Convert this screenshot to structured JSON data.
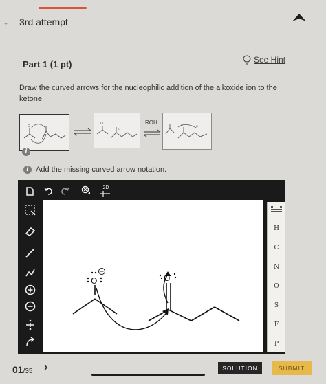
{
  "header": {
    "attempt_title": "3rd attempt",
    "accent_color": "#d9533a"
  },
  "part": {
    "title": "Part 1 (1 pt)",
    "hint_label": "See Hint"
  },
  "question": {
    "text": "Draw the curved arrows for the nucleophilic addition of the alkoxide ion to the ketone."
  },
  "mechanism": {
    "reagent_label": "ROH",
    "info_badge": "i"
  },
  "instruction": {
    "badge": "i",
    "text": "Add the missing curved arrow notation."
  },
  "toolbar": {
    "top_tools": [
      "document-icon",
      "undo-icon",
      "redo-icon",
      "zoom-icon",
      "2d-icon"
    ],
    "zoom_tool_label": "2D",
    "left_tools": [
      "select-icon",
      "eraser-icon",
      "bond-icon",
      "chain-icon",
      "plus-charge-icon",
      "minus-charge-icon",
      "electrons-icon",
      "curved-arrow-icon"
    ]
  },
  "periodic": {
    "elements": [
      "H",
      "C",
      "N",
      "O",
      "S",
      "F",
      "P"
    ]
  },
  "footer": {
    "page": "01",
    "total": "/35",
    "solution_label": "SOLUTION",
    "submit_label": "SUBMIT",
    "submit_color": "#e7b84a"
  }
}
